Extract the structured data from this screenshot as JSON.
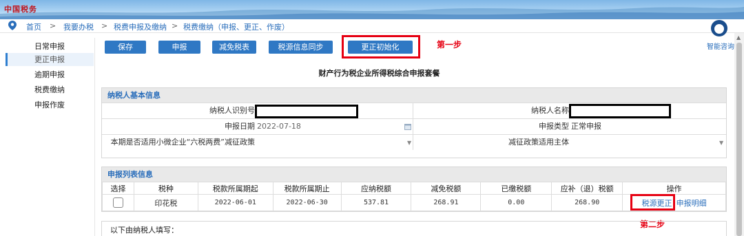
{
  "header": {
    "logo_text": "中国税务"
  },
  "breadcrumb": {
    "items": [
      "首页",
      "我要办税",
      "税费申报及缴纳",
      "税费缴纳（申报、更正、作废）"
    ],
    "sep": ">"
  },
  "sidebar": {
    "items": [
      {
        "label": "日常申报",
        "active": false
      },
      {
        "label": "更正申报",
        "active": true
      },
      {
        "label": "逾期申报",
        "active": false
      },
      {
        "label": "税费缴纳",
        "active": false
      },
      {
        "label": "申报作废",
        "active": false
      }
    ]
  },
  "toolbar": {
    "save": "保存",
    "declare": "申报",
    "relief": "减免税表",
    "sync": "税源信息同步",
    "correct_init": "更正初始化"
  },
  "annotations": {
    "step1": "第一步",
    "step2": "第二步",
    "highlight_color": "#e60012"
  },
  "page_title": "财产行为税企业所得税综合申报套餐",
  "taxpayer": {
    "section_title": "纳税人基本信息",
    "id_label": "纳税人识别号",
    "name_label": "纳税人名称",
    "date_label": "申报日期",
    "date_value": "2022-07-18",
    "type_label": "申报类型",
    "type_value": "正常申报",
    "policy_label": "本期是否适用小微企业“六税两费”减征政策",
    "policy_value": "",
    "subject_label": "减征政策适用主体",
    "subject_value": ""
  },
  "list": {
    "section_title": "申报列表信息",
    "columns": [
      "选择",
      "税种",
      "税款所属期起",
      "税款所属期止",
      "应纳税额",
      "减免税额",
      "已缴税额",
      "应补（退）税额",
      "操作"
    ],
    "rows": [
      {
        "tax": "印花税",
        "start": "2022-06-01",
        "end": "2022-06-30",
        "payable": "537.81",
        "relief": "268.91",
        "paid": "0.00",
        "due": "268.90",
        "op1": "税源更正",
        "op2": "申报明细"
      }
    ]
  },
  "footer_note": "以下由纳税人填写：",
  "helper": {
    "label": "智能咨询"
  },
  "accent_color": "#2f78c4"
}
